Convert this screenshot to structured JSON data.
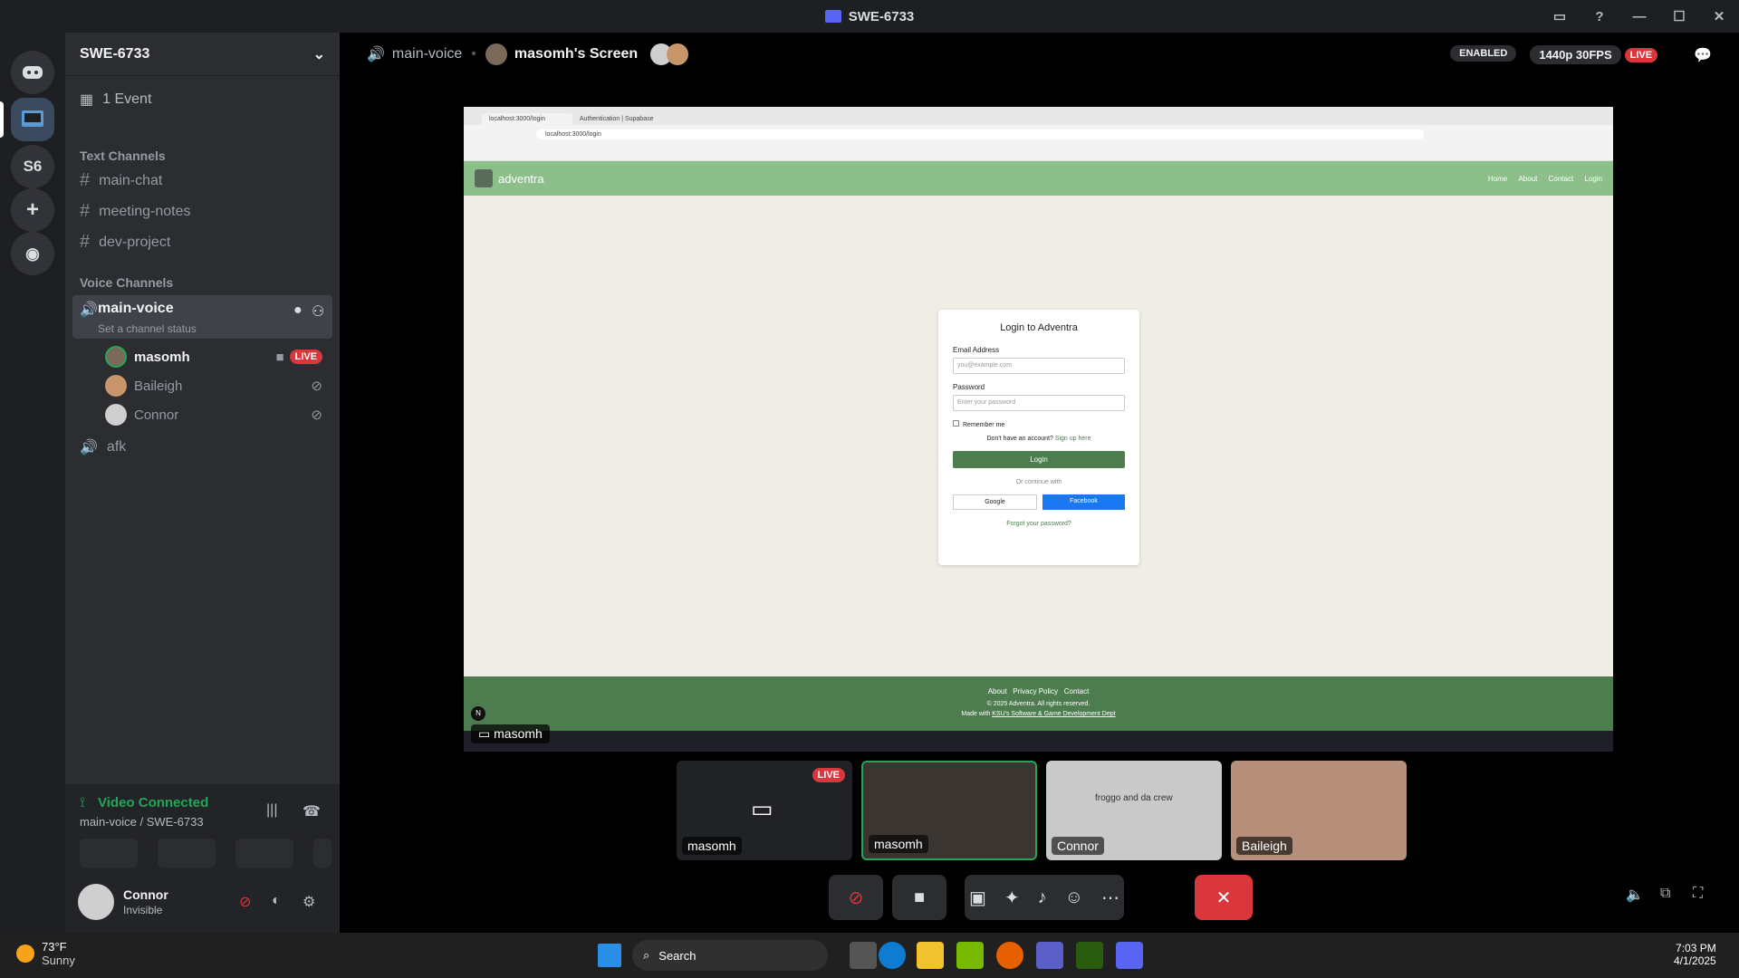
{
  "window": {
    "title": "SWE-6733"
  },
  "servers": {
    "s6_label": "S6"
  },
  "sidebar": {
    "guild_name": "SWE-6733",
    "event": "1 Event",
    "text_category": "Text Channels",
    "text_channels": [
      "main-chat",
      "meeting-notes",
      "dev-project"
    ],
    "voice_category": "Voice Channels",
    "voice_channel": "main-voice",
    "voice_status": "Set a channel status",
    "members": [
      {
        "name": "masomh",
        "badge": "LIVE"
      },
      {
        "name": "Baileigh"
      },
      {
        "name": "Connor"
      }
    ],
    "afk_channel": "afk"
  },
  "voice_panel": {
    "status": "Video Connected",
    "location": "main-voice / SWE-6733"
  },
  "user": {
    "name": "Connor",
    "status": "Invisible"
  },
  "header": {
    "channel": "main-voice",
    "screen": "masomh's Screen",
    "enabled_badge": "ENABLED",
    "quality": "1440p 30FPS",
    "live_badge": "LIVE"
  },
  "shared_screen": {
    "tabs": [
      "localhost:3000/login",
      "Authentication | Supabase"
    ],
    "url": "localhost:3000/login",
    "site_name": "adventra",
    "nav": [
      "Home",
      "About",
      "Contact",
      "Login"
    ],
    "login_title": "Login to Adventra",
    "email_label": "Email Address",
    "email_placeholder": "you@example.com",
    "password_label": "Password",
    "password_placeholder": "Enter your password",
    "remember": "Remember me",
    "no_account": "Don't have an account?",
    "signup": "Sign up here",
    "login_button": "Login",
    "or_continue": "Or continue with",
    "google": "Google",
    "facebook": "Facebook",
    "forgot": "Forgot your password?",
    "footer_links": [
      "About",
      "Privacy Policy",
      "Contact"
    ],
    "copyright": "© 2025 Adventra. All rights reserved.",
    "made_with": "Made with",
    "made_by": "KSU's Software & Game Development Dept",
    "streamer_tag": "masomh",
    "n_badge": "N"
  },
  "tiles": [
    {
      "name": "masomh",
      "badge": "LIVE"
    },
    {
      "name": "masomh"
    },
    {
      "name": "Connor",
      "caption": "froggo and da crew"
    },
    {
      "name": "Baileigh"
    }
  ],
  "taskbar": {
    "weather_temp": "73°F",
    "weather_desc": "Sunny",
    "search": "Search",
    "time": "7:03 PM",
    "date": "4/1/2025"
  },
  "colors": {
    "discord_blurple": "#5865f2",
    "live_red": "#da373c",
    "connected_green": "#23a55a",
    "site_green": "#4d7d4f"
  }
}
